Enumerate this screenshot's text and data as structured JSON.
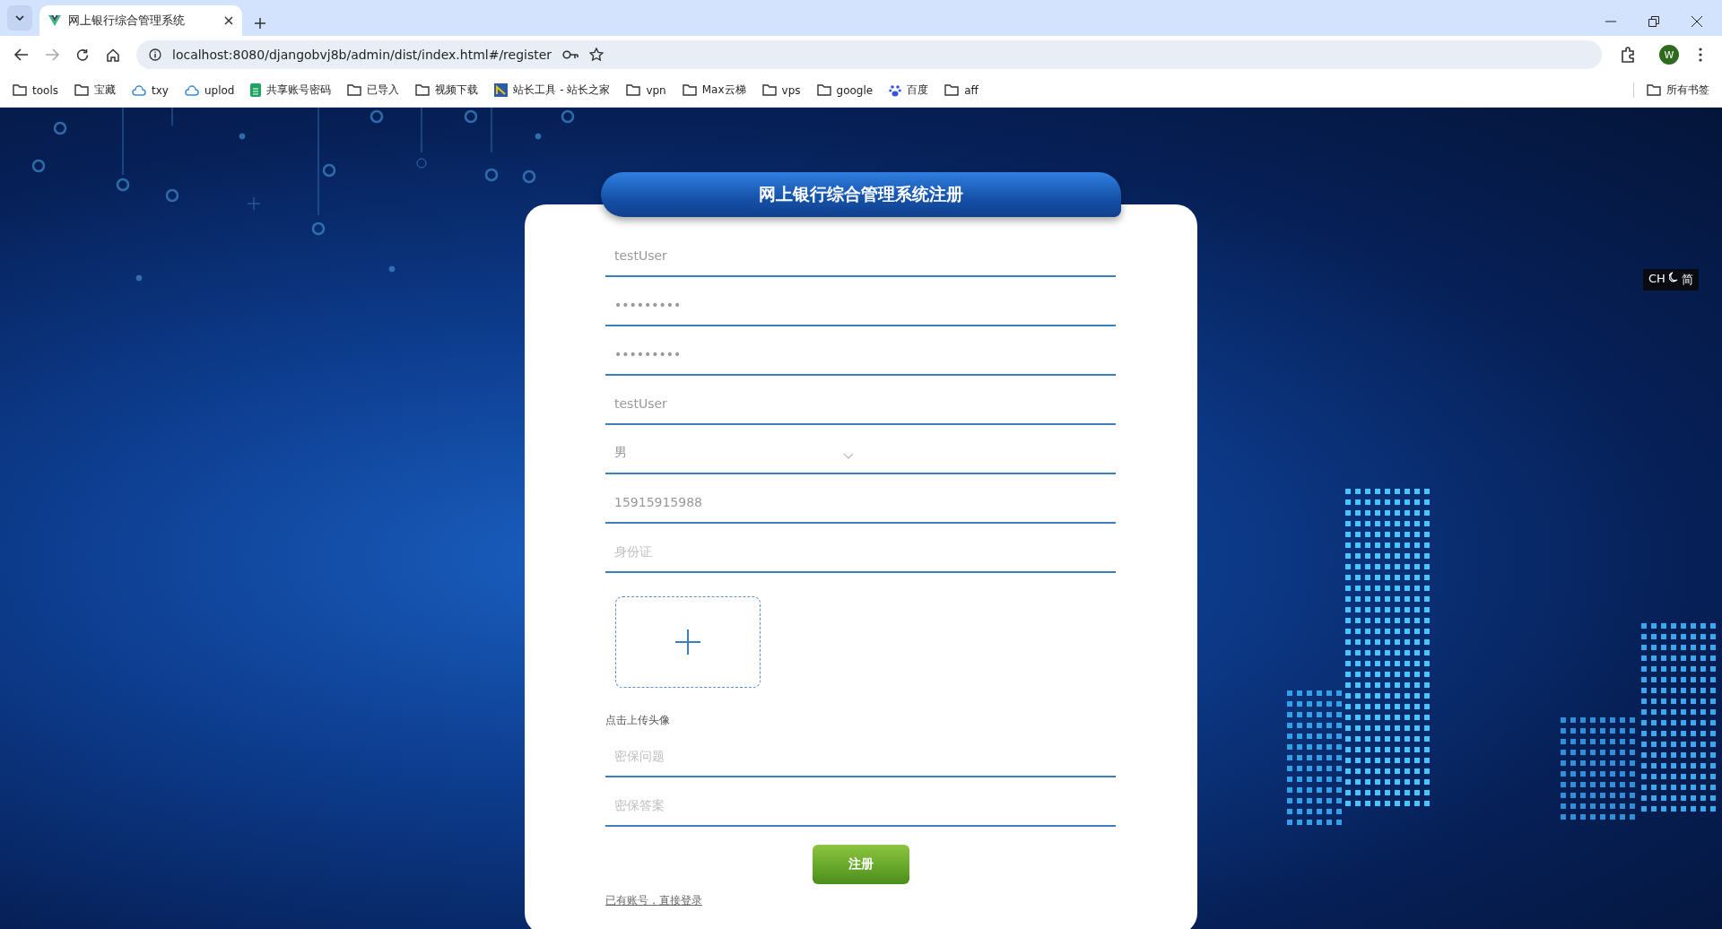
{
  "browser": {
    "tabs": [
      {
        "title": "网上银行综合管理系统",
        "selected": true
      }
    ],
    "url": "localhost:8080/djangobvj8b/admin/dist/index.html#/register",
    "bookmarks": [
      {
        "label": "tools",
        "kind": "folder"
      },
      {
        "label": "宝藏",
        "kind": "folder"
      },
      {
        "label": "txy",
        "kind": "cloud"
      },
      {
        "label": "uplod",
        "kind": "cloud"
      },
      {
        "label": "共享账号密码",
        "kind": "sheet"
      },
      {
        "label": "已导入",
        "kind": "folder"
      },
      {
        "label": "视频下载",
        "kind": "folder"
      },
      {
        "label": "站长工具 - 站长之家",
        "kind": "app"
      },
      {
        "label": "vpn",
        "kind": "folder"
      },
      {
        "label": "Max云梯",
        "kind": "folder"
      },
      {
        "label": "vps",
        "kind": "folder"
      },
      {
        "label": "google",
        "kind": "folder"
      },
      {
        "label": "百度",
        "kind": "paw"
      },
      {
        "label": "aff",
        "kind": "folder"
      }
    ],
    "all_bookmarks": "所有书签",
    "profile": "W"
  },
  "ime": {
    "language": "CH",
    "mode": "简"
  },
  "form": {
    "title": "网上银行综合管理系统注册",
    "fields_top": [
      {
        "kind": "text",
        "value": "testUser"
      },
      {
        "kind": "text",
        "value": "•••••••••"
      },
      {
        "kind": "text",
        "value": "•••••••••"
      },
      {
        "kind": "text",
        "value": "testUser"
      },
      {
        "kind": "select",
        "value": "男"
      },
      {
        "kind": "text",
        "value": "15915915988"
      },
      {
        "kind": "text",
        "placeholder": "身份证"
      }
    ],
    "upload_label": "点击上传头像",
    "fields_bottom": [
      {
        "kind": "text",
        "placeholder": "密保问题"
      },
      {
        "kind": "text",
        "placeholder": "密保答案"
      }
    ],
    "submit": "注册",
    "login_link": "已有账号，直接登录"
  }
}
